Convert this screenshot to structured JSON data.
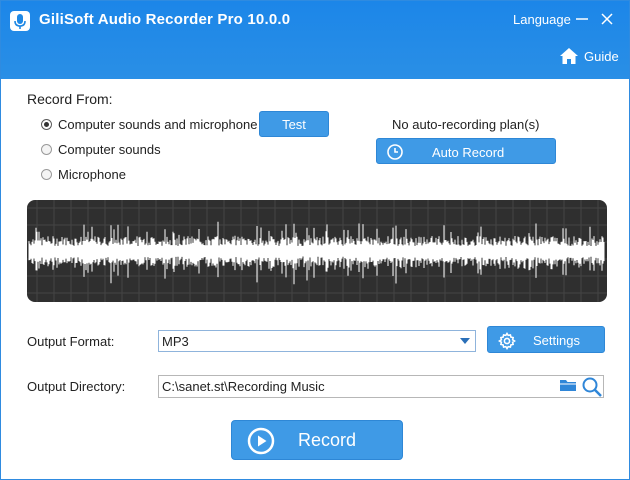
{
  "window": {
    "title": "GiliSoft Audio Recorder Pro 10.0.0",
    "language_label": "Language",
    "guide_label": "Guide"
  },
  "record_from": {
    "label": "Record  From:",
    "options": [
      {
        "label": "Computer sounds and microphone",
        "selected": true
      },
      {
        "label": "Computer sounds",
        "selected": false
      },
      {
        "label": "Microphone",
        "selected": false
      }
    ],
    "test_button": "Test"
  },
  "schedule": {
    "status": "No auto-recording plan(s)",
    "auto_record_button": "Auto Record"
  },
  "output": {
    "format_label": "Output Format:",
    "format_value": "MP3",
    "settings_button": "Settings",
    "directory_label": "Output Directory:",
    "directory_value": "C:\\sanet.st\\Recording Music"
  },
  "record_button": "Record",
  "colors": {
    "titlebar": "#1e88e5",
    "button": "#3f9ae6",
    "wave_panel": "#2f2f2f",
    "wave": "#ffffff"
  }
}
